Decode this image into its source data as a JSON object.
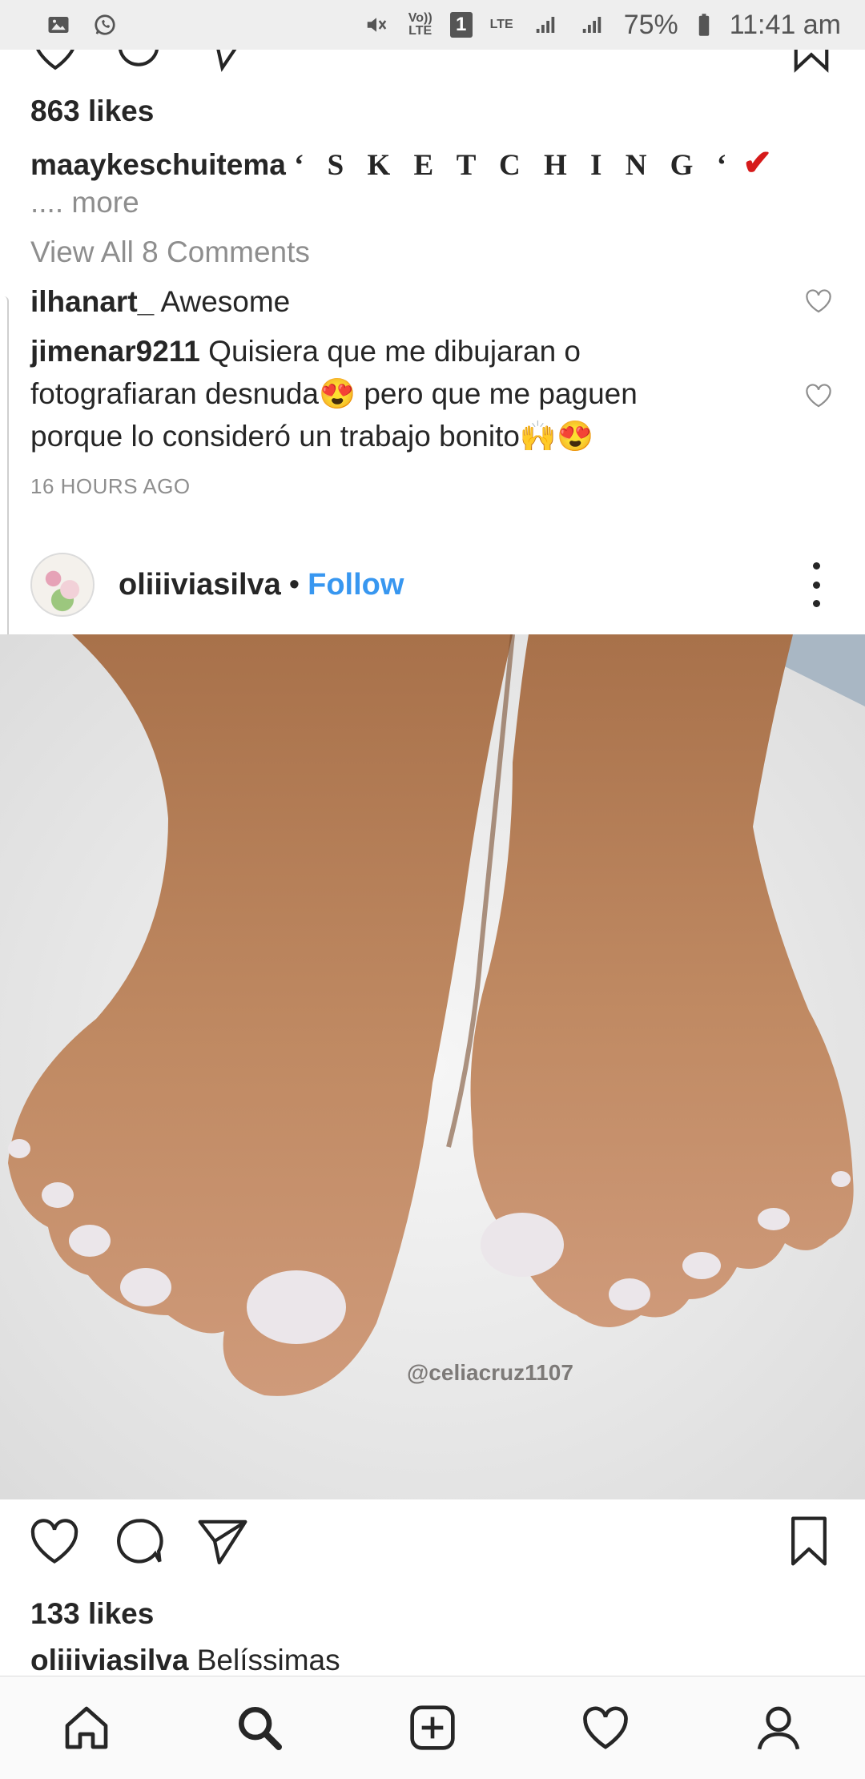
{
  "status_bar": {
    "icons_left": [
      "gallery-icon",
      "whatsapp-icon"
    ],
    "volte_label_top": "Vo))",
    "volte_label_bottom": "LTE",
    "sim_number": "1",
    "lte_label": "LTE",
    "battery_percent": "75%",
    "time": "11:41 am"
  },
  "previous_post": {
    "likes": "863 likes",
    "caption_user": "maaykeschuitema",
    "caption_text": "‘ S K E T C H I N G ‘",
    "caption_check": "✔",
    "more": ".... more",
    "view_all": "View All 8 Comments",
    "comments": [
      {
        "user": "ilhanart_",
        "text": " Awesome"
      },
      {
        "user": "jimenar9211",
        "text": " Quisiera que me dibujaran o fotografiaran desnuda😍 pero que me paguen porque lo consideró un trabajo bonito🙌😍"
      }
    ],
    "timestamp": "16 HOURS AGO"
  },
  "post": {
    "username": "oliiiviasilva",
    "separator": "•",
    "follow_label": "Follow",
    "watermark": "@celiacruz1107",
    "likes": "133 likes",
    "caption_user": "oliiiviasilva",
    "caption_text": " Belíssimas"
  },
  "bottom_nav": [
    "home-icon",
    "search-icon",
    "add-post-icon",
    "activity-heart-icon",
    "profile-icon"
  ],
  "colors": {
    "follow": "#3897f0",
    "check": "#d61a1a",
    "text": "#262626",
    "muted": "#8e8e8e"
  }
}
